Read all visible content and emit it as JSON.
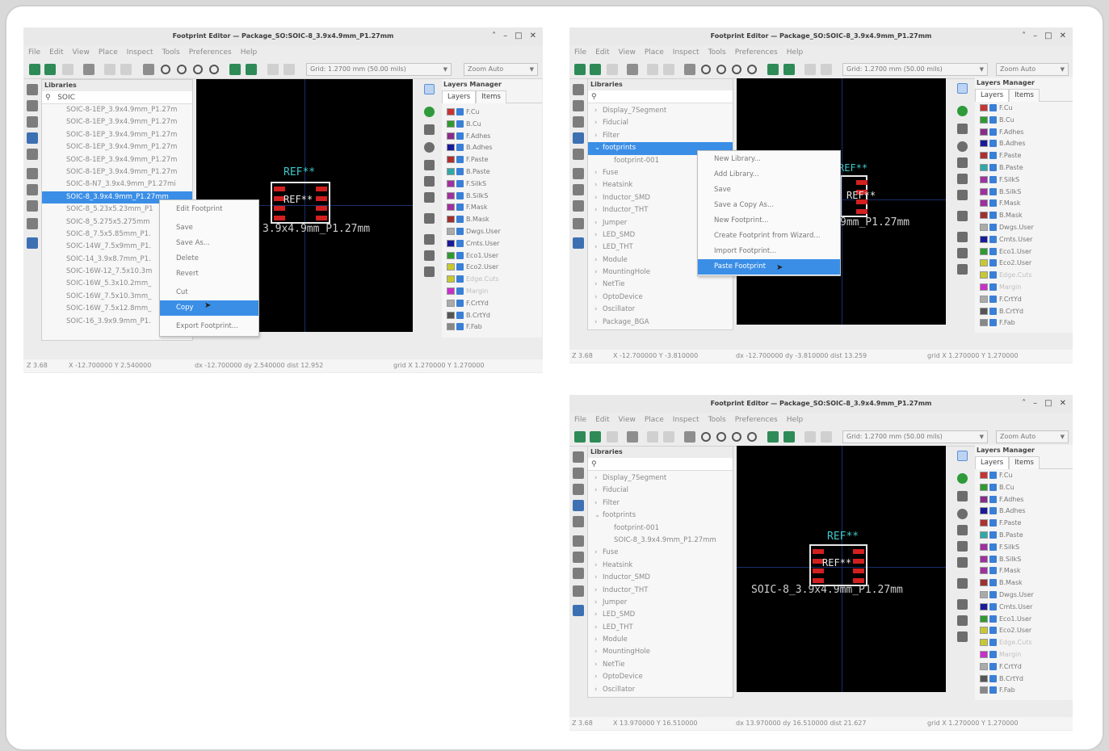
{
  "windows": [
    {
      "id": "w1",
      "title": "Footprint Editor — Package_SO:SOIC-8_3.9x4.9mm_P1.27mm",
      "menu": [
        "File",
        "Edit",
        "View",
        "Place",
        "Inspect",
        "Tools",
        "Preferences",
        "Help"
      ],
      "grid": "Grid: 1.2700 mm (50.00 mils)",
      "zoom": "Zoom Auto",
      "libraries_header": "Libraries",
      "search": "SOIC",
      "tree": [
        {
          "label": "SOIC-8-1EP_3.9x4.9mm_P1.27m",
          "selected": false
        },
        {
          "label": "SOIC-8-1EP_3.9x4.9mm_P1.27m",
          "selected": false
        },
        {
          "label": "SOIC-8-1EP_3.9x4.9mm_P1.27m",
          "selected": false
        },
        {
          "label": "SOIC-8-1EP_3.9x4.9mm_P1.27m",
          "selected": false
        },
        {
          "label": "SOIC-8-1EP_3.9x4.9mm_P1.27m",
          "selected": false
        },
        {
          "label": "SOIC-8-1EP_3.9x4.9mm_P1.27m",
          "selected": false
        },
        {
          "label": "SOIC-8-N7_3.9x4.9mm_P1.27mi",
          "selected": false
        },
        {
          "label": "SOIC-8_3.9x4.9mm_P1.27mm",
          "selected": true
        },
        {
          "label": "SOIC-8_5.23x5.23mm_P1",
          "selected": false
        },
        {
          "label": "SOIC-8_5.275x5.275mm",
          "selected": false
        },
        {
          "label": "SOIC-8_7.5x5.85mm_P1.",
          "selected": false
        },
        {
          "label": "SOIC-14W_7.5x9mm_P1.",
          "selected": false
        },
        {
          "label": "SOIC-14_3.9x8.7mm_P1.",
          "selected": false
        },
        {
          "label": "SOIC-16W-12_7.5x10.3m",
          "selected": false
        },
        {
          "label": "SOIC-16W_5.3x10.2mm_",
          "selected": false
        },
        {
          "label": "SOIC-16W_7.5x10.3mm_",
          "selected": false
        },
        {
          "label": "SOIC-16W_7.5x12.8mm_",
          "selected": false
        },
        {
          "label": "SOIC-16_3.9x9.9mm_P1.",
          "selected": false
        }
      ],
      "canvas_ref": "REF**",
      "canvas_ref2": "REF**",
      "canvas_name": "3.9x4.9mm_P1.27mm",
      "context_menu": [
        "Edit Footprint",
        "",
        "Save",
        "Save As...",
        "Delete",
        "Revert",
        "",
        "Cut",
        "Copy",
        "",
        "Export Footprint..."
      ],
      "context_selected": "Copy",
      "status": {
        "z": "Z 3.68",
        "xy": "X -12.700000  Y 2.540000",
        "d": "dx -12.700000  dy 2.540000  dist 12.952",
        "grid": "grid X 1.270000  Y 1.270000"
      }
    },
    {
      "id": "w2",
      "title": "Footprint Editor — Package_SO:SOIC-8_3.9x4.9mm_P1.27mm",
      "menu": [
        "File",
        "Edit",
        "View",
        "Place",
        "Inspect",
        "Tools",
        "Preferences",
        "Help"
      ],
      "grid": "Grid: 1.2700 mm (50.00 mils)",
      "zoom": "Zoom Auto",
      "libraries_header": "Libraries",
      "search": "",
      "tree": [
        {
          "label": "Display_7Segment",
          "selected": false,
          "child": false,
          "open": false
        },
        {
          "label": "Fiducial",
          "selected": false,
          "child": false,
          "open": false
        },
        {
          "label": "Filter",
          "selected": false,
          "child": false,
          "open": false
        },
        {
          "label": "footprints",
          "selected": true,
          "child": false,
          "open": true
        },
        {
          "label": "footprint-001",
          "selected": false,
          "child": true,
          "open": false
        },
        {
          "label": "Fuse",
          "selected": false,
          "child": false,
          "open": false
        },
        {
          "label": "Heatsink",
          "selected": false,
          "child": false,
          "open": false
        },
        {
          "label": "Inductor_SMD",
          "selected": false,
          "child": false,
          "open": false
        },
        {
          "label": "Inductor_THT",
          "selected": false,
          "child": false,
          "open": false
        },
        {
          "label": "Jumper",
          "selected": false,
          "child": false,
          "open": false
        },
        {
          "label": "LED_SMD",
          "selected": false,
          "child": false,
          "open": false
        },
        {
          "label": "LED_THT",
          "selected": false,
          "child": false,
          "open": false
        },
        {
          "label": "Module",
          "selected": false,
          "child": false,
          "open": false
        },
        {
          "label": "MountingHole",
          "selected": false,
          "child": false,
          "open": false
        },
        {
          "label": "NetTie",
          "selected": false,
          "child": false,
          "open": false
        },
        {
          "label": "OptoDevice",
          "selected": false,
          "child": false,
          "open": false
        },
        {
          "label": "Oscillator",
          "selected": false,
          "child": false,
          "open": false
        },
        {
          "label": "Package_BGA",
          "selected": false,
          "child": false,
          "open": false
        }
      ],
      "canvas_ref": "REF**",
      "canvas_ref2": "REF**",
      "canvas_name": "9mm_P1.27mm",
      "context_menu": [
        "New Library...",
        "Add Library...",
        "Save",
        "Save a Copy As...",
        "New Footprint...",
        "Create Footprint from Wizard...",
        "Import Footprint...",
        "Paste Footprint"
      ],
      "context_selected": "Paste Footprint",
      "status": {
        "z": "Z 3.68",
        "xy": "X -12.700000  Y -3.810000",
        "d": "dx -12.700000  dy -3.810000  dist 13.259",
        "grid": "grid X 1.270000  Y 1.270000"
      }
    },
    {
      "id": "w3",
      "title": "Footprint Editor — Package_SO:SOIC-8_3.9x4.9mm_P1.27mm",
      "menu": [
        "File",
        "Edit",
        "View",
        "Place",
        "Inspect",
        "Tools",
        "Preferences",
        "Help"
      ],
      "grid": "Grid: 1.2700 mm (50.00 mils)",
      "zoom": "Zoom Auto",
      "libraries_header": "Libraries",
      "search": "",
      "tree": [
        {
          "label": "Display_7Segment",
          "selected": false,
          "child": false,
          "open": false
        },
        {
          "label": "Fiducial",
          "selected": false,
          "child": false,
          "open": false
        },
        {
          "label": "Filter",
          "selected": false,
          "child": false,
          "open": false
        },
        {
          "label": "footprints",
          "selected": false,
          "child": false,
          "open": true
        },
        {
          "label": "footprint-001",
          "selected": false,
          "child": true,
          "open": false
        },
        {
          "label": "SOIC-8_3.9x4.9mm_P1.27mm",
          "selected": false,
          "child": true,
          "open": false
        },
        {
          "label": "Fuse",
          "selected": false,
          "child": false,
          "open": false
        },
        {
          "label": "Heatsink",
          "selected": false,
          "child": false,
          "open": false
        },
        {
          "label": "Inductor_SMD",
          "selected": false,
          "child": false,
          "open": false
        },
        {
          "label": "Inductor_THT",
          "selected": false,
          "child": false,
          "open": false
        },
        {
          "label": "Jumper",
          "selected": false,
          "child": false,
          "open": false
        },
        {
          "label": "LED_SMD",
          "selected": false,
          "child": false,
          "open": false
        },
        {
          "label": "LED_THT",
          "selected": false,
          "child": false,
          "open": false
        },
        {
          "label": "Module",
          "selected": false,
          "child": false,
          "open": false
        },
        {
          "label": "MountingHole",
          "selected": false,
          "child": false,
          "open": false
        },
        {
          "label": "NetTie",
          "selected": false,
          "child": false,
          "open": false
        },
        {
          "label": "OptoDevice",
          "selected": false,
          "child": false,
          "open": false
        },
        {
          "label": "Oscillator",
          "selected": false,
          "child": false,
          "open": false
        }
      ],
      "canvas_ref": "REF**",
      "canvas_ref2": "REF**",
      "canvas_name": "SOIC-8_3.9x4.9mm_P1.27mm",
      "context_menu": [],
      "context_selected": "",
      "status": {
        "z": "Z 3.68",
        "xy": "X 13.970000  Y 16.510000",
        "d": "dx 13.970000  dy 16.510000  dist 21.627",
        "grid": "grid X 1.270000  Y 1.270000"
      }
    }
  ],
  "layers_manager": {
    "title": "Layers Manager",
    "tabs": [
      "Layers",
      "Items"
    ],
    "layers": [
      {
        "name": "F.Cu",
        "color": "#c83434",
        "dim": false
      },
      {
        "name": "B.Cu",
        "color": "#2f9a2f",
        "dim": false
      },
      {
        "name": "F.Adhes",
        "color": "#8a2b8a",
        "dim": false
      },
      {
        "name": "B.Adhes",
        "color": "#1a1a9a",
        "dim": false
      },
      {
        "name": "F.Paste",
        "color": "#b03030",
        "dim": false
      },
      {
        "name": "B.Paste",
        "color": "#30a8a8",
        "dim": false
      },
      {
        "name": "F.SilkS",
        "color": "#a030a0",
        "dim": false
      },
      {
        "name": "B.SilkS",
        "color": "#a030a0",
        "dim": false
      },
      {
        "name": "F.Mask",
        "color": "#a030a0",
        "dim": false
      },
      {
        "name": "B.Mask",
        "color": "#a03030",
        "dim": false
      },
      {
        "name": "Dwgs.User",
        "color": "#aaaaaa",
        "dim": false
      },
      {
        "name": "Cmts.User",
        "color": "#1a1a9a",
        "dim": false
      },
      {
        "name": "Eco1.User",
        "color": "#2f9a2f",
        "dim": false
      },
      {
        "name": "Eco2.User",
        "color": "#c8c830",
        "dim": false
      },
      {
        "name": "Edge.Cuts",
        "color": "#c8c830",
        "dim": true
      },
      {
        "name": "Margin",
        "color": "#c830c8",
        "dim": true
      },
      {
        "name": "F.CrtYd",
        "color": "#aaaaaa",
        "dim": false
      },
      {
        "name": "B.CrtYd",
        "color": "#555555",
        "dim": false
      },
      {
        "name": "F.Fab",
        "color": "#888888",
        "dim": false
      }
    ]
  }
}
